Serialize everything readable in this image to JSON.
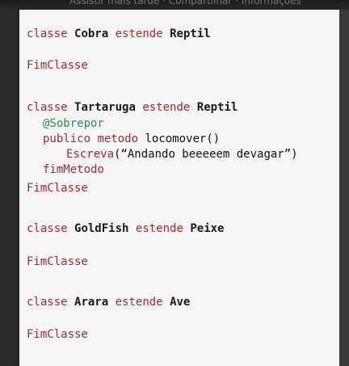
{
  "video_bar": {
    "overlay_text": "Assistir mais tarde · Compartilhar · Informações"
  },
  "code": {
    "class1": {
      "kw_classe": "classe",
      "name": "Cobra",
      "kw_estende": "estende",
      "parent": "Reptil",
      "end": "FimClasse"
    },
    "class2": {
      "kw_classe": "classe",
      "name": "Tartaruga",
      "kw_estende": "estende",
      "parent": "Reptil",
      "annotation": "@Sobrepor",
      "kw_publico": "publico",
      "kw_metodo": "metodo",
      "method_sig": "locomover()",
      "kw_escreva": "Escreva",
      "escreva_arg": "(“Andando beeeeem devagar”)",
      "kw_fim_metodo": "fimMetodo",
      "end": "FimClasse"
    },
    "class3": {
      "kw_classe": "classe",
      "name": "GoldFish",
      "kw_estende": "estende",
      "parent": "Peixe",
      "end": "FimClasse"
    },
    "class4": {
      "kw_classe": "classe",
      "name": "Arara",
      "kw_estende": "estende",
      "parent": "Ave",
      "end": "FimClasse"
    }
  },
  "colors": {
    "keyword": "#a52a2a",
    "annotation": "#2e8b57",
    "identifier": "#1a1a1a",
    "background": "#f5f5f5"
  }
}
